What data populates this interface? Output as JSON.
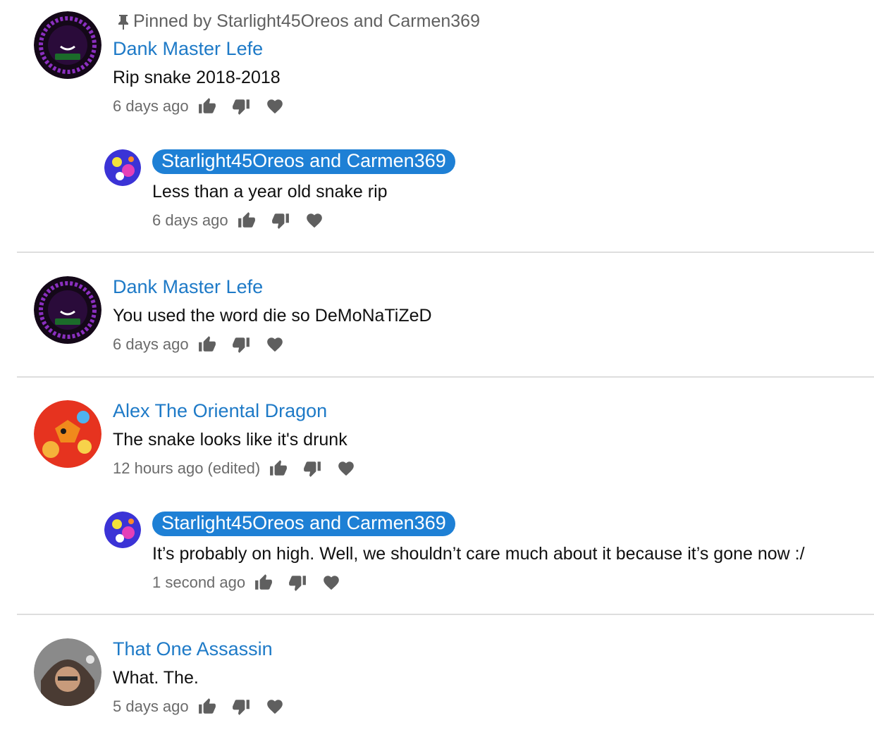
{
  "pinned": {
    "label": "Pinned by Starlight45Oreos and Carmen369"
  },
  "comments": [
    {
      "author": "Dank Master Lefe",
      "text": "Rip snake 2018-2018",
      "time": "6 days ago",
      "reply": {
        "author": "Starlight45Oreos and Carmen369",
        "text": "Less than a year old snake rip",
        "time": "6 days ago"
      }
    },
    {
      "author": "Dank Master Lefe",
      "text": "You used the word die so DeMoNaTiZeD",
      "time": "6 days ago"
    },
    {
      "author": "Alex The Oriental Dragon",
      "text": "The snake looks like it's drunk",
      "time": "12 hours ago (edited)",
      "reply": {
        "author": "Starlight45Oreos and Carmen369",
        "text": "It’s probably on high. Well, we shouldn’t care much about it because it’s gone now :/",
        "time": "1 second ago"
      }
    },
    {
      "author": "That One Assassin",
      "text": "What. The.",
      "time": "5 days ago"
    }
  ],
  "icons": {
    "pin": "pin-icon",
    "like": "thumbs-up-icon",
    "dislike": "thumbs-down-icon",
    "heart": "heart-icon"
  },
  "colors": {
    "author_link": "#1e7ac7",
    "owner_badge": "#1e80d5",
    "icon_gray": "#5f5f5f",
    "divider": "#dedede"
  }
}
